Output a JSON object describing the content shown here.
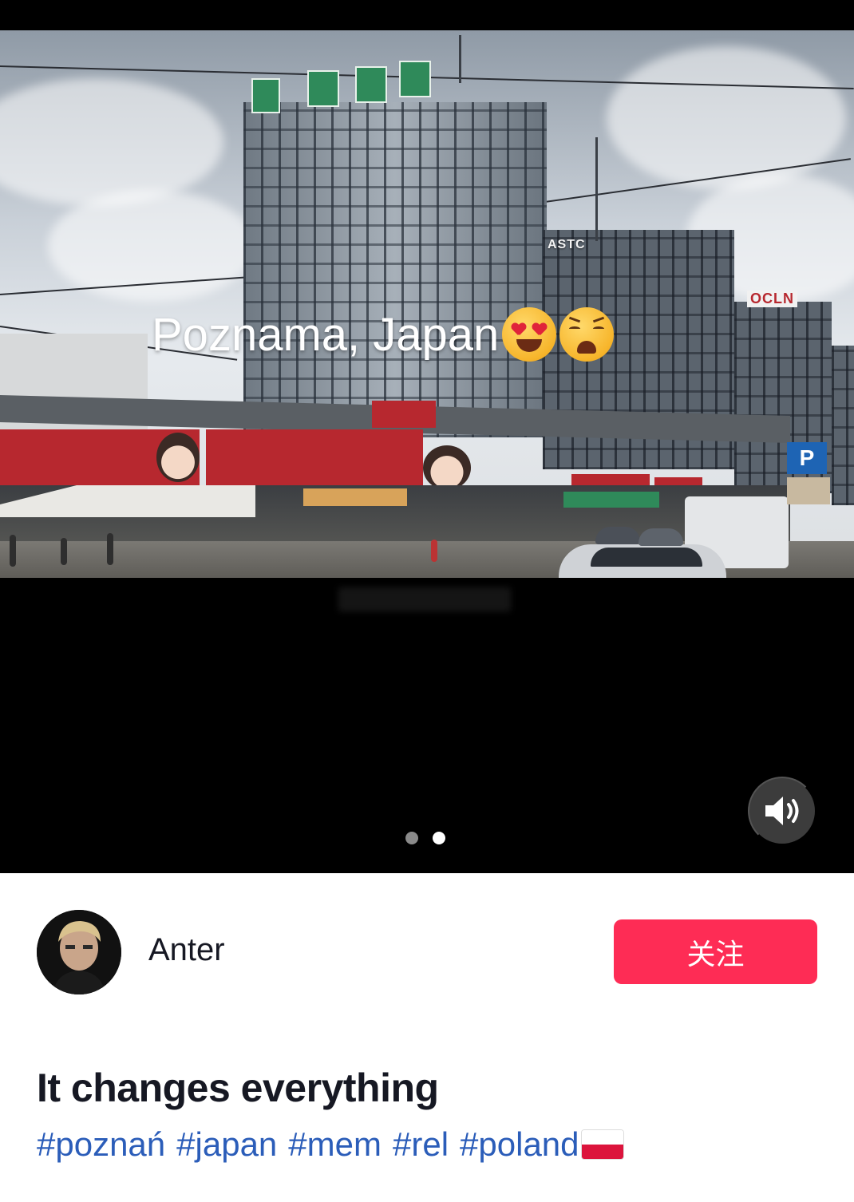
{
  "video": {
    "overlay_title": "Poznama, Japan",
    "overlay_emojis": [
      "smiling-face-with-heart-eyes-icon",
      "weary-face-icon"
    ],
    "building_labels": [
      "ASTC",
      "OCLN"
    ],
    "carousel": {
      "count": 2,
      "active_index": 1,
      "inactive_color": "#8a8a8a",
      "active_color": "#ffffff"
    },
    "sound_icon": "speaker-volume-icon"
  },
  "author": {
    "name": "Anter",
    "follow_label": "关注",
    "follow_color": "#fe2c55"
  },
  "caption": {
    "title": "It changes everything",
    "hashtags": [
      "#poznań",
      "#japan",
      "#mem",
      "#rel",
      "#poland"
    ],
    "hashtag_color": "#2b5db9",
    "flag_icon": "poland-flag-icon"
  }
}
